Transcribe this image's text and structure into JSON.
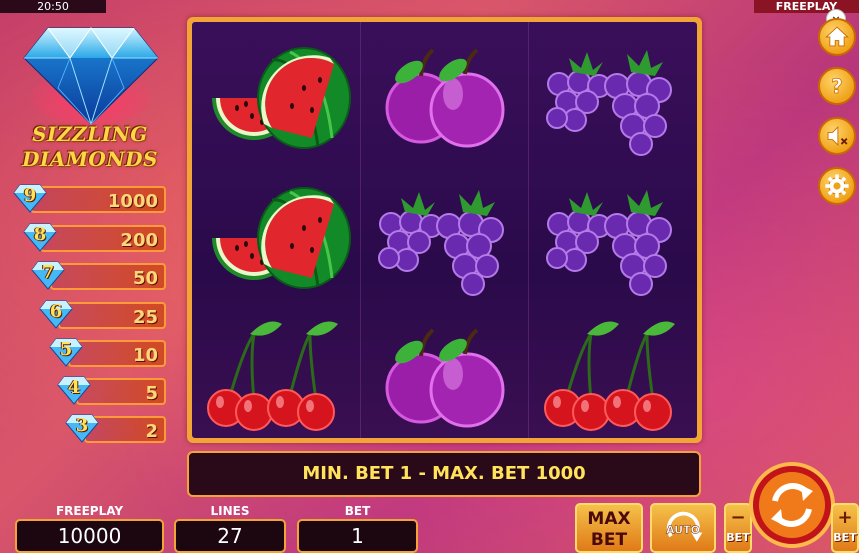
{
  "status_bar": {
    "time": "20:50",
    "mode": "FREEPLAY"
  },
  "close_label": "×",
  "logo": {
    "line1": "SIZZLING",
    "line2": "DIAMONDS"
  },
  "paytable": [
    {
      "count": "9",
      "value": "1000"
    },
    {
      "count": "8",
      "value": "200"
    },
    {
      "count": "7",
      "value": "50"
    },
    {
      "count": "6",
      "value": "25"
    },
    {
      "count": "5",
      "value": "10"
    },
    {
      "count": "4",
      "value": "5"
    },
    {
      "count": "3",
      "value": "2"
    }
  ],
  "reels": [
    [
      "watermelon",
      "watermelon",
      "cherries"
    ],
    [
      "plums",
      "grapes",
      "plums"
    ],
    [
      "grapes",
      "grapes",
      "cherries"
    ]
  ],
  "bet_info": "MIN. BET 1 - MAX. BET 1000",
  "counters": {
    "freeplay": {
      "label": "FREEPLAY",
      "value": "10000"
    },
    "lines": {
      "label": "LINES",
      "value": "27"
    },
    "bet": {
      "label": "BET",
      "value": "1"
    }
  },
  "buttons": {
    "max_bet_line1": "MAX",
    "max_bet_line2": "BET",
    "auto": "AUTO",
    "bet_minus_sign": "−",
    "bet_minus_word": "BET",
    "bet_plus_sign": "+",
    "bet_plus_word": "BET"
  },
  "side_icons": [
    "home-icon",
    "help-icon",
    "sound-muted-icon",
    "settings-icon"
  ],
  "colors": {
    "frame": "#f2a436",
    "reel_bg": "#2a0a4a",
    "text_gold": "#ffe35a"
  }
}
